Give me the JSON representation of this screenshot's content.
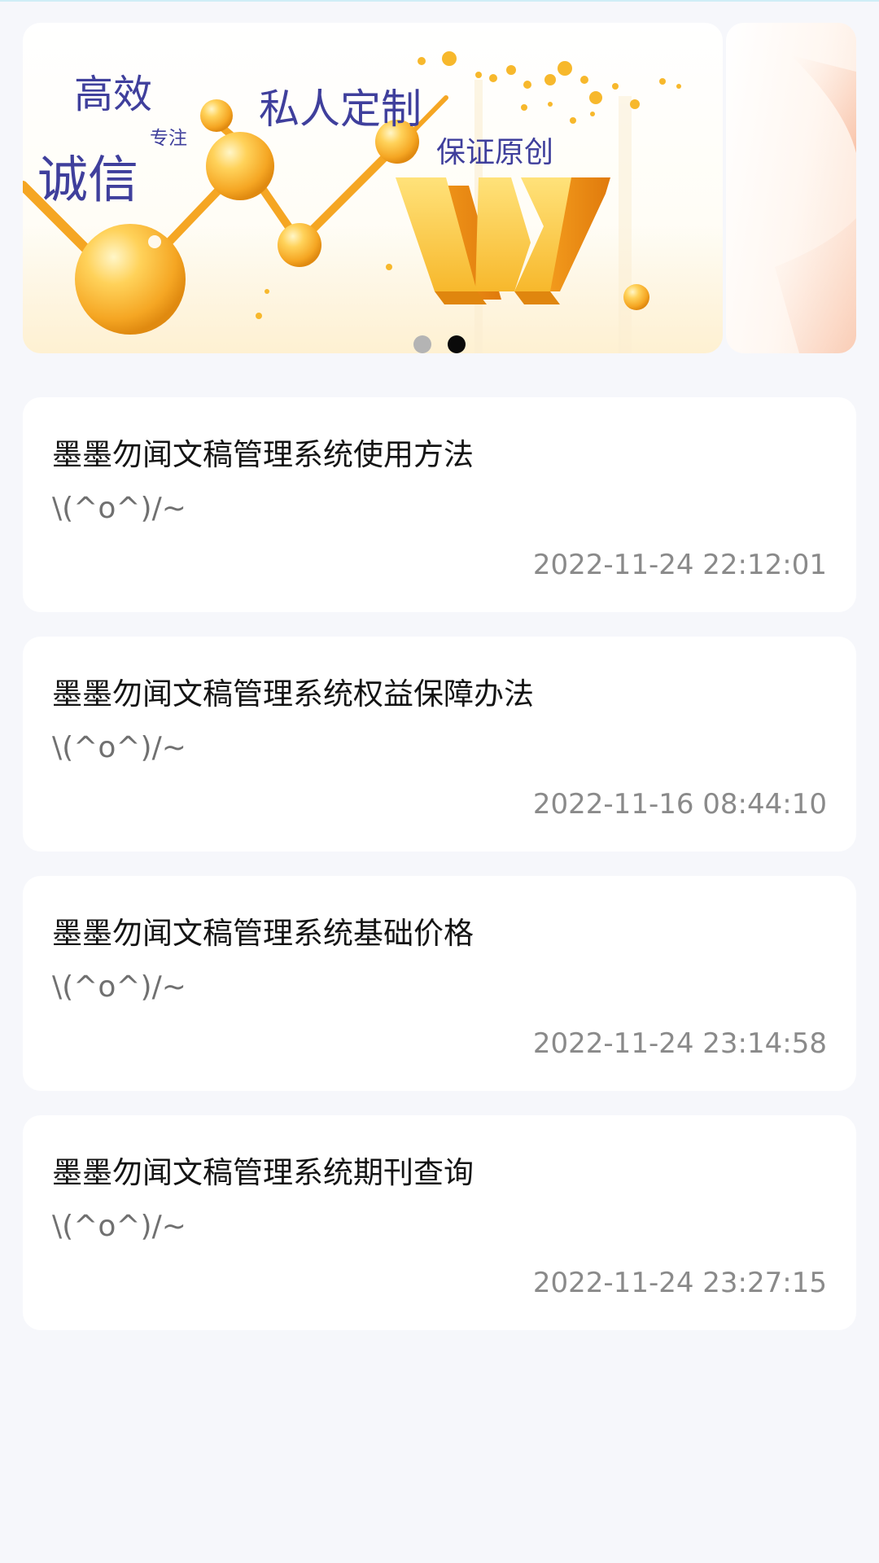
{
  "banner": {
    "words": {
      "gaoxiao": "高效",
      "zhuanzhu": "专注",
      "chengxin": "诚信",
      "siren": "私人定制",
      "baozheng": "保证原创"
    },
    "letter": "W",
    "active_slide": 2,
    "slide_count": 2
  },
  "news": [
    {
      "title": "墨墨勿闻文稿管理系统使用方法",
      "subtitle": "\\(^o^)/~",
      "date": "2022-11-24 22:12:01"
    },
    {
      "title": "墨墨勿闻文稿管理系统权益保障办法",
      "subtitle": "\\(^o^)/~",
      "date": "2022-11-16 08:44:10"
    },
    {
      "title": "墨墨勿闻文稿管理系统基础价格",
      "subtitle": "\\(^o^)/~",
      "date": "2022-11-24 23:14:58"
    },
    {
      "title": "墨墨勿闻文稿管理系统期刊查询",
      "subtitle": "\\(^o^)/~",
      "date": "2022-11-24 23:27:15"
    }
  ],
  "colors": {
    "page_background": "#f6f7fb",
    "banner_text": "#3f3f9c",
    "gold": "#f7b82c",
    "dot_active": "#0a0a0a",
    "dot_inactive": "#b4b4b4"
  }
}
